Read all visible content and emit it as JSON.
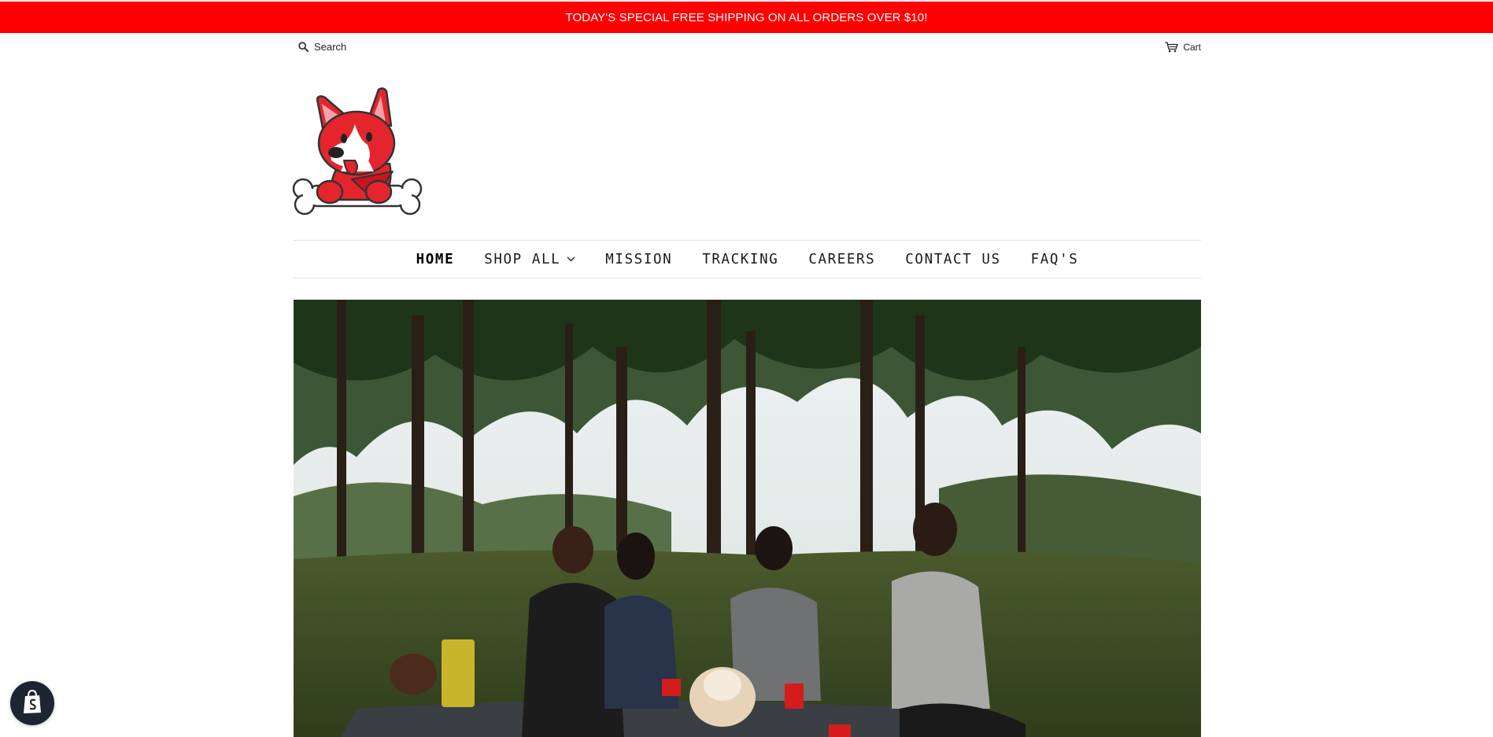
{
  "announcement": {
    "text": "TODAY'S SPECIAL FREE SHIPPING ON ALL ORDERS OVER $10!",
    "background": "#ff0000"
  },
  "header": {
    "search_label": "Search",
    "search_icon": "search-icon",
    "cart_label": "Cart",
    "cart_icon": "cart-icon"
  },
  "logo": {
    "name": "corgi-bone-logo",
    "accent": "#e4252d"
  },
  "nav": {
    "items": [
      {
        "label": "HOME",
        "active": true
      },
      {
        "label": "SHOP ALL",
        "has_dropdown": true
      },
      {
        "label": "MISSION"
      },
      {
        "label": "TRACKING"
      },
      {
        "label": "CAREERS"
      },
      {
        "label": "CONTACT US"
      },
      {
        "label": "FAQ'S"
      }
    ]
  },
  "hero": {
    "image": "friends-picnic-with-dog-photo"
  },
  "shopify_badge": {
    "icon": "shopify-bag-icon"
  }
}
